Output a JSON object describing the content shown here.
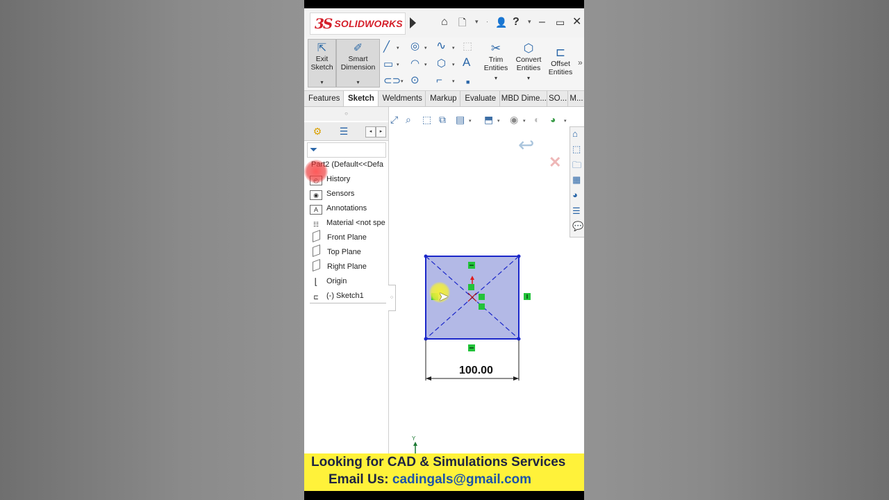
{
  "app": {
    "brand_mark": "3S",
    "brand_name": "SOLIDWORKS"
  },
  "titlebar": {
    "icons": [
      "home-icon",
      "new-document-icon",
      "user-icon",
      "help-icon",
      "minimize-icon",
      "maximize-icon",
      "close-icon"
    ]
  },
  "command_manager": {
    "exit_sketch": {
      "line1": "Exit",
      "line2": "Sketch"
    },
    "smart_dimension": {
      "line1": "Smart",
      "line2": "Dimension"
    },
    "trim_entities": {
      "line1": "Trim",
      "line2": "Entities"
    },
    "convert_entities": {
      "line1": "Convert",
      "line2": "Entities"
    },
    "offset_entities": {
      "line1": "Offset",
      "line2": "Entities"
    },
    "more": "»"
  },
  "tabs": [
    {
      "label": "Features"
    },
    {
      "label": "Sketch",
      "active": true
    },
    {
      "label": "Weldments"
    },
    {
      "label": "Markup"
    },
    {
      "label": "Evaluate"
    },
    {
      "label": "MBD Dime..."
    },
    {
      "label": "SO..."
    },
    {
      "label": "M..."
    }
  ],
  "feature_tree": {
    "root": "Part2  (Default<<Defa",
    "items": [
      {
        "label": "History",
        "icon": "history-folder-icon"
      },
      {
        "label": "Sensors",
        "icon": "sensors-icon"
      },
      {
        "label": "Annotations",
        "icon": "annotations-icon"
      },
      {
        "label": "Material <not spe",
        "icon": "material-icon"
      },
      {
        "label": "Front Plane",
        "icon": "plane-icon"
      },
      {
        "label": "Top Plane",
        "icon": "plane-icon"
      },
      {
        "label": "Right Plane",
        "icon": "plane-icon"
      },
      {
        "label": "Origin",
        "icon": "origin-icon"
      },
      {
        "label": "(-) Sketch1",
        "icon": "sketch-icon"
      }
    ]
  },
  "sketch": {
    "dimension": "100.00",
    "fill_color": "#b3b9e6",
    "line_color": "#1b27c9",
    "relation_color": "#22c33a",
    "origin_label": "Y"
  },
  "banner": {
    "line1": "Looking for CAD & Simulations Services",
    "line2_label": "Email Us: ",
    "email": "cadingals@gmail.com"
  }
}
